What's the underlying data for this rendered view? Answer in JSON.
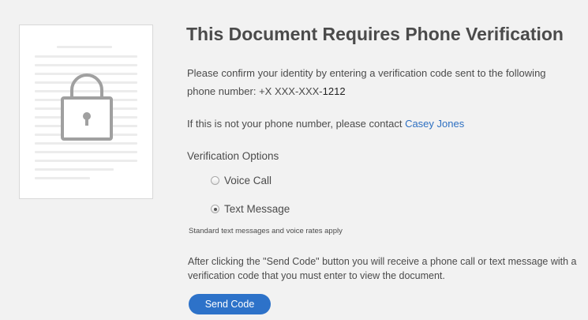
{
  "header": {
    "title": "This Document Requires Phone Verification"
  },
  "instructions": {
    "text": "Please confirm your identity by entering a verification code sent to the following phone number: +X XXX-XXX-",
    "phone_last_digits": "1212"
  },
  "contact": {
    "prefix": "If this is not your phone number, please contact ",
    "name": "Casey Jones"
  },
  "verification": {
    "heading": "Verification Options",
    "options": [
      {
        "label": "Voice Call",
        "selected": false
      },
      {
        "label": "Text Message",
        "selected": true
      }
    ],
    "rates_note": "Standard text messages and voice rates apply"
  },
  "after_text": "After clicking the \"Send Code\" button you will receive a phone call or text message with a verification code that you must enter to view the document.",
  "send_button_label": "Send Code",
  "icons": {
    "document": "document-icon",
    "lock": "lock-icon"
  },
  "colors": {
    "background": "#f2f2f2",
    "link": "#2d6fc1",
    "button": "#2d72c9",
    "text": "#4b4b4b"
  }
}
